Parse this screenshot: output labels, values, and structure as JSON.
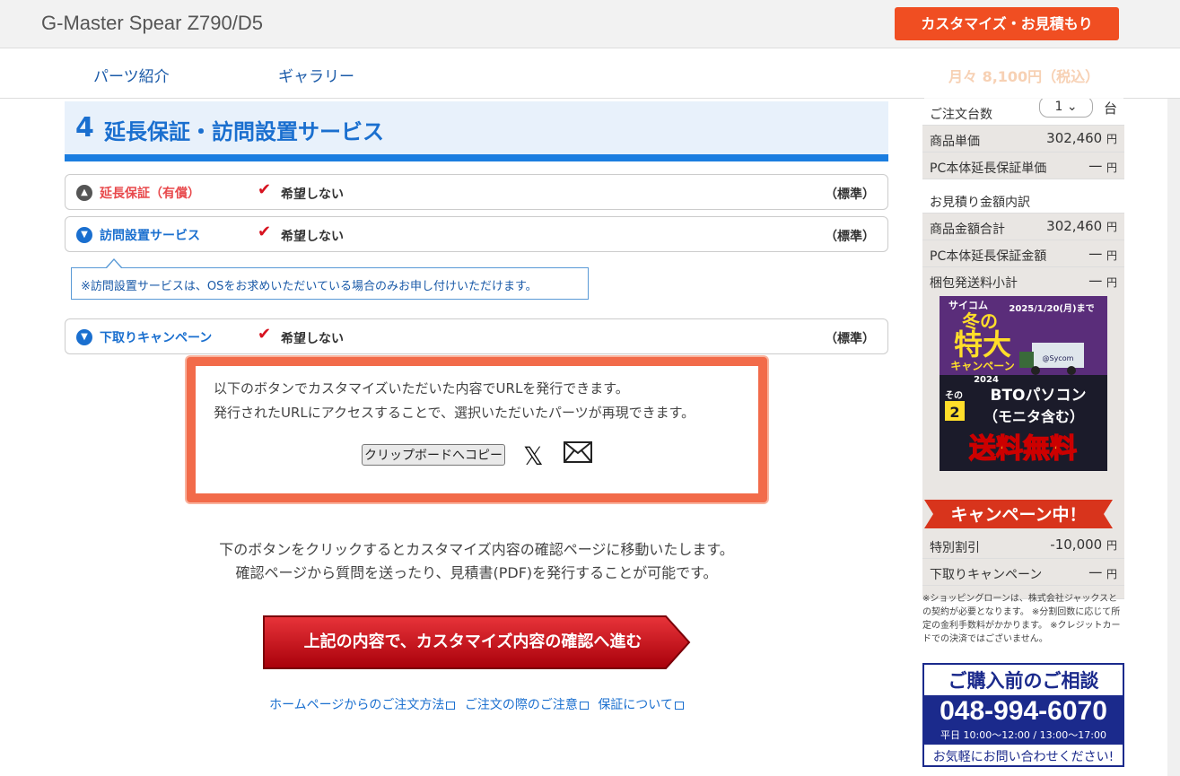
{
  "header": {
    "product_title": "G-Master Spear Z790/D5",
    "cta_label": "カスタマイズ・お見積もり",
    "monthly_price": "月々 8,100円（税込）"
  },
  "subnav": {
    "items": [
      {
        "label": "パーツ紹介"
      },
      {
        "label": "ギャラリー"
      }
    ]
  },
  "section": {
    "number": "4",
    "title": "延長保証・訪問設置サービス",
    "options": [
      {
        "label": "延長保証（有償）",
        "icon": "triangle-up-icon",
        "color": "#e8494c",
        "value": "希望しない",
        "std": "（標準）"
      },
      {
        "label": "訪問設置サービス",
        "icon": "triangle-down-icon",
        "color": "#1a6fcf",
        "value": "希望しない",
        "std": "（標準）"
      },
      {
        "label": "下取りキャンペーン",
        "icon": "triangle-down-icon",
        "color": "#1a6fcf",
        "value": "希望しない",
        "std": "（標準）"
      }
    ],
    "note": "※訪問設置サービスは、OSをお求めいただいている場合のみお申し付けいただけます。"
  },
  "share": {
    "line1": "以下のボタンでカスタマイズいただいた内容でURLを発行できます。",
    "line2": "発行されたURLにアクセスすることで、選択いただいたパーツが再現できます。",
    "copy_label": "クリップボードへコピー",
    "x_glyph": "𝕏"
  },
  "info": {
    "line1": "下のボタンをクリックするとカスタマイズ内容の確認ページに移動いたします。",
    "line2": "確認ページから質問を送ったり、見積書(PDF)を発行することが可能です。"
  },
  "main_cta": "上記の内容で、カスタマイズ内容の確認へ進む",
  "footer_links": [
    "ホームページからのご注文方法",
    "ご注文の際のご注意",
    "保証について"
  ],
  "sidebar": {
    "qty_label": "ご注文台数",
    "qty_value": "1",
    "qty_unit": "台",
    "unit_price_label": "商品単価",
    "unit_price": "302,460",
    "warranty_unit_label": "PC本体延長保証単価",
    "warranty_unit": "一",
    "breakdown_label": "お見積り金額内訳",
    "total_label": "商品金額合計",
    "total": "302,460",
    "warranty_total_label": "PC本体延長保証金額",
    "warranty_total": "一",
    "shipping_label": "梱包発送料小計",
    "shipping": "一",
    "yen": "円",
    "banner1": {
      "brand": "サイコム",
      "date": "2025/1/20(月)まで",
      "big": "特大",
      "winter": "冬の",
      "campaign": "キャンペーン",
      "year": "2024",
      "sono": "その",
      "sono_num": "2",
      "bto": "BTOパソコン",
      "monitor": "（モニタ含む）",
      "free": "送料無料",
      "truck_label": "@Sycom"
    },
    "banner2": "キャンペーン中！",
    "discount_label": "特別割引",
    "discount": "-10,000",
    "tradein_label": "下取りキャンペーン",
    "tradein": "一",
    "fineprint": "※ショッピングローンは、株式会社ジャックスとの契約が必要となります。 ※分割回数に応じて所定の金利手数料がかかります。 ※クレジットカードでの決済ではございません。",
    "consult": {
      "title": "ご購入前のご相談",
      "phone": "048-994-6070",
      "hours": "平日 10:00～12:00 / 13:00～17:00",
      "foot": "お気軽にお問い合わせください!"
    }
  }
}
